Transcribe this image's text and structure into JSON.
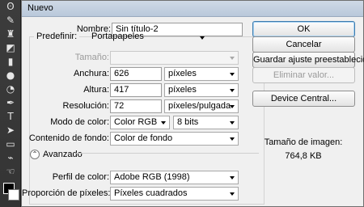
{
  "toolbar": {
    "tools": [
      {
        "name": "lasso-icon",
        "glyph": "ʘ"
      },
      {
        "name": "brush-icon",
        "glyph": "✎"
      },
      {
        "name": "stamp-icon",
        "glyph": "♜"
      },
      {
        "name": "eraser-icon",
        "glyph": "◩"
      },
      {
        "name": "gradient-icon",
        "glyph": "▮"
      },
      {
        "name": "blur-icon",
        "glyph": "●"
      },
      {
        "name": "dodge-icon",
        "glyph": "◔"
      },
      {
        "name": "pen-icon",
        "glyph": "✒"
      },
      {
        "name": "type-icon",
        "glyph": "T"
      },
      {
        "name": "path-select-icon",
        "glyph": "➤"
      },
      {
        "name": "rectangle-icon",
        "glyph": "▭"
      },
      {
        "name": "eyedropper-icon",
        "glyph": "⌁"
      },
      {
        "name": "hand-icon",
        "glyph": "☜"
      },
      {
        "name": "zoom-icon",
        "glyph": "⚲"
      }
    ],
    "foreground_color": "#000000",
    "background_color": "#ffffff"
  },
  "dialog": {
    "title": "Nuevo",
    "nombre_label": "Nombre:",
    "nombre_value": "Sin título-2",
    "predefinir_label": "Predefinir:",
    "predefinir_value": "Portapapeles",
    "tamano_label": "Tamaño:",
    "anchura_label": "Anchura:",
    "anchura_value": "626",
    "anchura_unit": "píxeles",
    "altura_label": "Altura:",
    "altura_value": "417",
    "altura_unit": "píxeles",
    "resolucion_label": "Resolución:",
    "resolucion_value": "72",
    "resolucion_unit": "píxeles/pulgada",
    "modo_label": "Modo de color:",
    "modo_value": "Color RGB",
    "bits_value": "8 bits",
    "contenido_label": "Contenido de fondo:",
    "contenido_value": "Color de fondo",
    "avanzado_label": "Avanzado",
    "perfil_label": "Perfil de color:",
    "perfil_value": "Adobe RGB (1998)",
    "proporcion_label": "Proporción de píxeles:",
    "proporcion_value": "Píxeles cuadrados",
    "ok_button": "OK",
    "cancel_button": "Cancelar",
    "save_preset_button": "Guardar ajuste preestablecido...",
    "delete_preset_button": "Eliminar valor...",
    "device_central_button": "Device Central...",
    "image_size_label": "Tamaño de imagen:",
    "image_size_value": "764,8 KB"
  }
}
